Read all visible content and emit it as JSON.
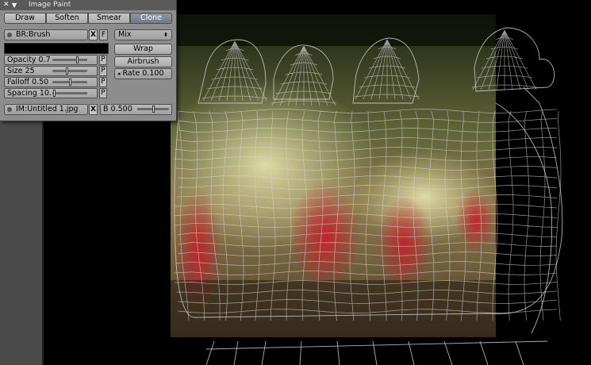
{
  "panel": {
    "title": "Image Paint",
    "close_glyph": "✕",
    "collapse_glyph": "▼",
    "tools": [
      "Draw",
      "Soften",
      "Smear",
      "Clone"
    ],
    "active_tool": "Clone",
    "brush_name": "BR:Brush",
    "brush_unlink": "X",
    "brush_fake": "F",
    "blend_mode": "Mix",
    "blend_arrow": "⬍",
    "wrap_label": "Wrap",
    "airbrush_label": "Airbrush",
    "rate_label": "Rate 0.100",
    "brush_color": "#000000",
    "sliders": [
      {
        "label": "Opacity 0.7",
        "value": 0.7,
        "pressure": "P"
      },
      {
        "label": "Size 25",
        "value": 0.4,
        "pressure": "P"
      },
      {
        "label": "Falloff 0.50",
        "value": 0.5,
        "pressure": "P"
      },
      {
        "label": "Spacing 10.",
        "value": 0.05,
        "pressure": "P"
      }
    ],
    "clone_image": "IM:Untitled 1.jpg",
    "clone_unlink": "X",
    "clone_blend_label": "B 0.500",
    "clone_blend_value": 0.5
  },
  "colors": {
    "active_button": "#6f7a86",
    "panel_bg": "#8d8d8d",
    "wire": "#cfcfcf"
  }
}
